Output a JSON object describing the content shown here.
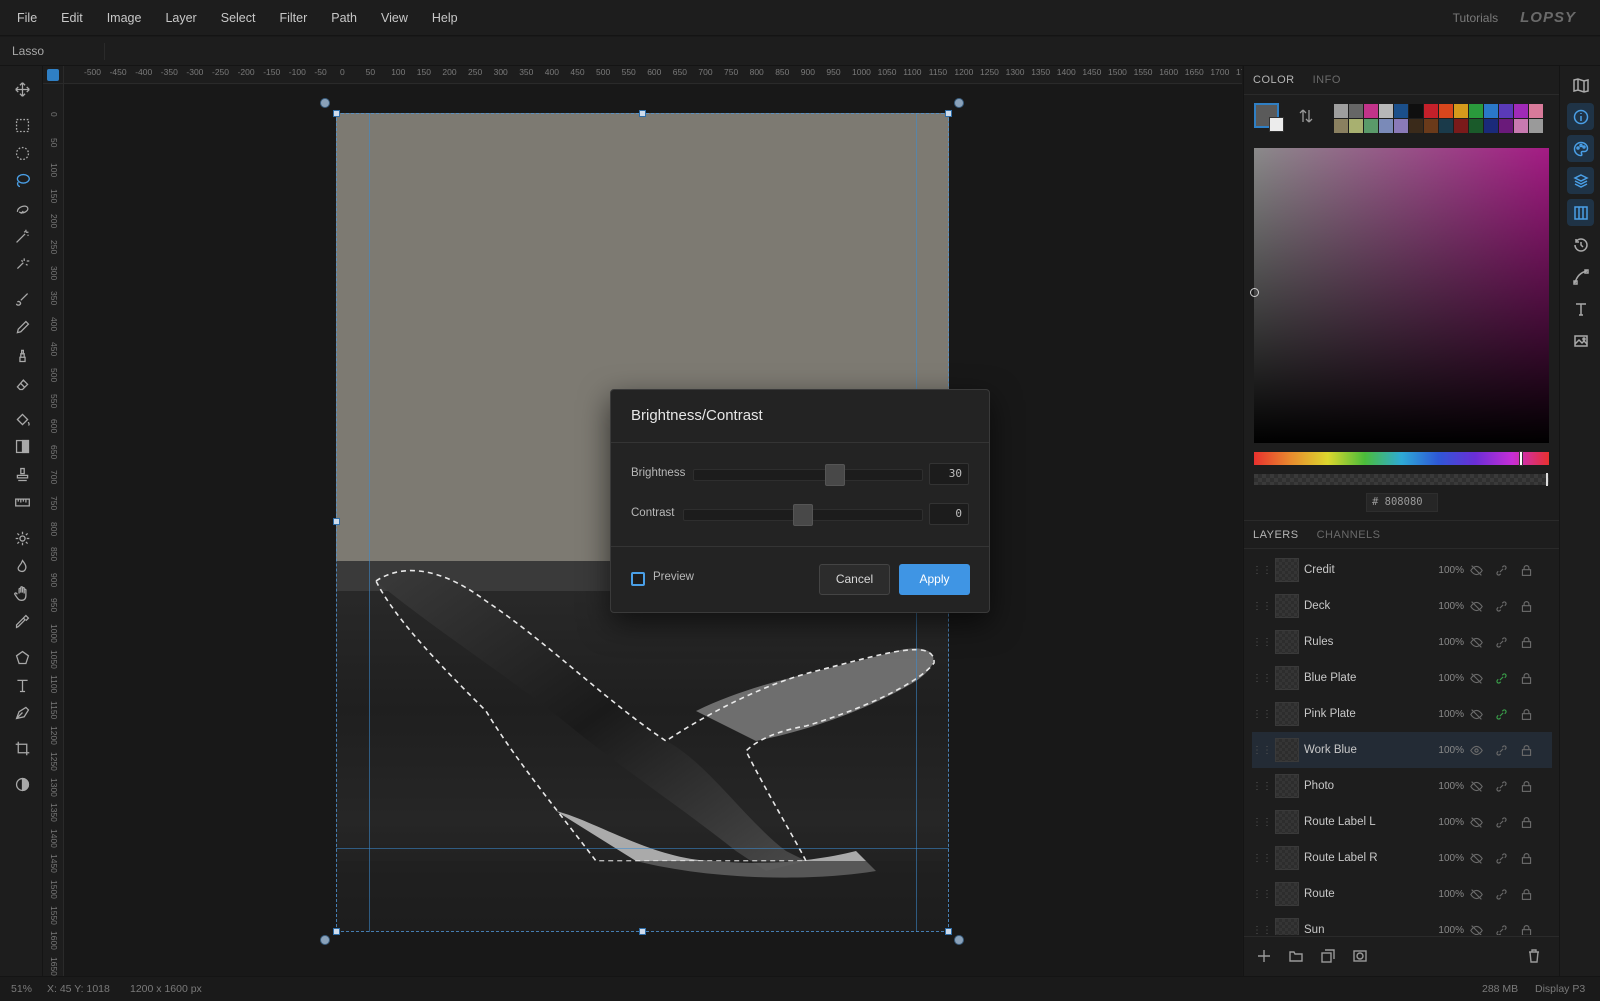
{
  "menubar": {
    "items": [
      "File",
      "Edit",
      "Image",
      "Layer",
      "Select",
      "Filter",
      "Path",
      "View",
      "Help"
    ],
    "tutorials": "Tutorials",
    "logo": "LOPSY"
  },
  "options_bar": {
    "tool_name": "Lasso"
  },
  "ruler": {
    "top_labels": [
      "-500",
      "-450",
      "-400",
      "-350",
      "-300",
      "-250",
      "-200",
      "-150",
      "-100",
      "-50",
      "0",
      "50",
      "100",
      "150",
      "200",
      "250",
      "300",
      "350",
      "400",
      "450",
      "500",
      "550",
      "600",
      "650",
      "700",
      "750",
      "800",
      "850",
      "900",
      "950",
      "1000",
      "1050",
      "1100",
      "1150",
      "1200",
      "1250",
      "1300",
      "1350",
      "1400",
      "1450",
      "1500",
      "1550",
      "1600",
      "1650",
      "1700",
      "17"
    ],
    "left_labels": [
      "0",
      "50",
      "100",
      "150",
      "200",
      "250",
      "300",
      "350",
      "400",
      "450",
      "500",
      "550",
      "600",
      "650",
      "700",
      "750",
      "800",
      "850",
      "900",
      "950",
      "1000",
      "1050",
      "1100",
      "1150",
      "1200",
      "1250",
      "1300",
      "1350",
      "1400",
      "1450",
      "1500",
      "1550",
      "1600",
      "1650"
    ]
  },
  "tools": [
    "move-icon",
    "rect-select-icon",
    "ellipse-select-icon",
    "lasso-icon",
    "quick-select-icon",
    "magic-wand-icon",
    "spot-heal-icon",
    "brush-icon",
    "pencil-icon",
    "clone-icon",
    "eraser-icon",
    "bucket-icon",
    "gradient-icon",
    "stamp-icon",
    "ruler-icon",
    "dodge-icon",
    "burn-icon",
    "hand-icon",
    "eyedropper-icon",
    "shape-icon",
    "type-icon",
    "pen-icon",
    "crop-icon",
    "contrast-icon"
  ],
  "panel": {
    "color_tabs": [
      "COLOR",
      "INFO"
    ],
    "hex_value": "808080",
    "hex_prefix": "#",
    "swatches": [
      "#9e9e9e",
      "#666666",
      "#c2338a",
      "#b7b7b7",
      "#1b4f8a",
      "#0f0f0f",
      "#c4202a",
      "#d8461c",
      "#d59a1c",
      "#2a9a3c",
      "#2a78c8",
      "#5a3ab8",
      "#a02ab8",
      "#d87a9a",
      "#8a8060",
      "#a8b070",
      "#5a9a6a",
      "#7a8ab8",
      "#8a7ab8",
      "#3a2a1a",
      "#6a3a1a",
      "#1a3a4a",
      "#7a1a1a",
      "#1a5a2a",
      "#1a2a7a",
      "#6a1a7a",
      "#c87ab0",
      "#9a9a9a"
    ],
    "layers_tabs": [
      "LAYERS",
      "CHANNELS"
    ],
    "layers": [
      {
        "name": "Credit",
        "opacity": "100%",
        "visible": false,
        "linked": false
      },
      {
        "name": "Deck",
        "opacity": "100%",
        "visible": false,
        "linked": false
      },
      {
        "name": "Rules",
        "opacity": "100%",
        "visible": false,
        "linked": false
      },
      {
        "name": "Blue Plate",
        "opacity": "100%",
        "visible": false,
        "linked": true
      },
      {
        "name": "Pink Plate",
        "opacity": "100%",
        "visible": false,
        "linked": true
      },
      {
        "name": "Work Blue",
        "opacity": "100%",
        "visible": true,
        "linked": false,
        "selected": true
      },
      {
        "name": "Photo",
        "opacity": "100%",
        "visible": false,
        "linked": false
      },
      {
        "name": "Route Label L",
        "opacity": "100%",
        "visible": false,
        "linked": false
      },
      {
        "name": "Route Label R",
        "opacity": "100%",
        "visible": false,
        "linked": false
      },
      {
        "name": "Route",
        "opacity": "100%",
        "visible": false,
        "linked": false
      },
      {
        "name": "Sun",
        "opacity": "100%",
        "visible": false,
        "linked": false
      }
    ]
  },
  "dialog": {
    "title": "Brightness/Contrast",
    "brightness_label": "Brightness",
    "brightness_value": "30",
    "brightness_fraction": 0.63,
    "contrast_label": "Contrast",
    "contrast_value": "0",
    "contrast_fraction": 0.5,
    "preview_label": "Preview",
    "cancel_label": "Cancel",
    "apply_label": "Apply"
  },
  "status": {
    "zoom": "51%",
    "coords": "X: 45 Y: 1018",
    "doc_size": "1200 x 1600 px",
    "memory": "288 MB",
    "color_profile": "Display P3"
  },
  "colors": {
    "accent": "#3f95e4",
    "sky": "#7d7a72",
    "selected_layer": "#232b35"
  }
}
